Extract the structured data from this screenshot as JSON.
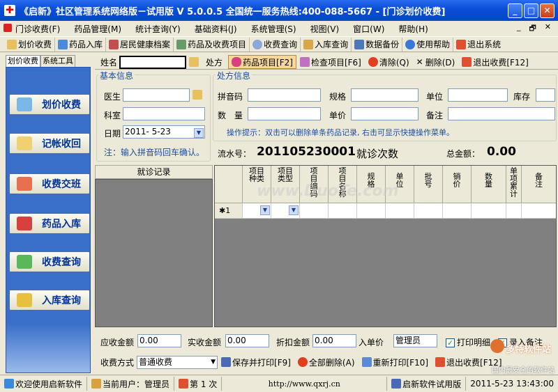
{
  "window": {
    "title": "《启新》社区管理系统网络版－试用版 V 5.0.0.5  全国统一服务热线:400-088-5667 - [门诊划价收费]",
    "min": "_",
    "max": "□",
    "close": "✕"
  },
  "menu": [
    "门诊收费(F)",
    "药品管理(M)",
    "统计查询(Y)",
    "基础资料(J)",
    "系统管理(S)",
    "视图(V)",
    "窗口(W)",
    "帮助(H)"
  ],
  "menu_right": [
    "_",
    "🗗",
    "✕"
  ],
  "toolbar": [
    "划价收费",
    "药品入库",
    "居民健康档案",
    "药品及收费项目",
    "收费查询",
    "入库查询",
    "数据备份",
    "使用帮助",
    "退出系统"
  ],
  "lefttabs": [
    "划价收费",
    "系统工具"
  ],
  "nav": [
    "划价收费",
    "记帐收回",
    "收费交班",
    "药品入库",
    "收费查询",
    "入库查询"
  ],
  "header": {
    "name_label": "姓名",
    "rx_label": "处方",
    "buttons": [
      "药品项目[F2]",
      "检查项目[F6]",
      "清除(Q)",
      "删除(D)",
      "退出收费[F12]"
    ]
  },
  "basic": {
    "title": "基本信息",
    "doctor": "医生",
    "dept": "科室",
    "date": "日期",
    "date_value": "2011- 5-23",
    "note": "注：输入拼音码回车确认。"
  },
  "rx": {
    "title": "处方信息",
    "pinyin": "拼音码",
    "spec": "规格",
    "unit": "单位",
    "stock": "库存",
    "qty": "数　量",
    "price": "单价",
    "remark": "备注",
    "hint": "操作提示：双击可以删除单条药品记录, 右击可显示快捷操作菜单。"
  },
  "serial": {
    "label": "流水号：",
    "value": "201105230001",
    "visits": "就诊次数",
    "total_label": "总金额：",
    "total": "0.00"
  },
  "records_title": "就诊记录",
  "grid": {
    "columns": [
      "项目种类",
      "项目类型",
      "项目编码",
      "项目名称",
      "规格",
      "单位",
      "批号",
      "销价",
      "数量",
      "单项累计",
      "备注"
    ],
    "row_marker": "✱1"
  },
  "watermark": "www.DuoTe.com",
  "amounts": {
    "due_label": "应收金额",
    "due": "0.00",
    "paid_label": "实收金额",
    "paid": "0.00",
    "discount_label": "折扣金额",
    "discount": "0.00",
    "entry_label": "入单价",
    "operator": "管理员",
    "print_detail": "打印明细",
    "record_remark": "录入备注"
  },
  "actions": {
    "pay_method_label": "收费方式",
    "pay_method": "普通收费",
    "save_print": "保存并打印[F9]",
    "delete_all": "全部删除(A)",
    "reprint": "重新打印[F10]",
    "exit": "退出收费[F12]"
  },
  "status": {
    "welcome": "欢迎使用启新软件",
    "user": "当前用户：管理员",
    "times": "第 1 次",
    "url": "http://www.qxrj.cn",
    "edition": "启新软件试用版",
    "datetime": "2011-5-23 13:43:00"
  },
  "logo": {
    "name": "多特软件站",
    "sub": "国内最安全的软件站"
  },
  "colors": {
    "title_blue": "#0a4fd8",
    "nav_text": "#003399",
    "panel_blue": "#3a6fc9",
    "accent": "#1a4ea8"
  }
}
